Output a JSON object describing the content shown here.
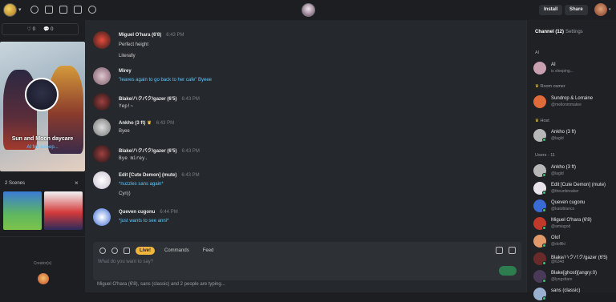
{
  "top": {
    "install_label": "Install",
    "share_label": "Share"
  },
  "left": {
    "stats": {
      "hearts": "0",
      "chats": "0"
    },
    "scene": {
      "title": "Sun and Moon daycare",
      "status": "AI fell asleep..."
    },
    "scenes_label": "2 Scenes",
    "creators_label": "Creator(s)"
  },
  "messages": [
    {
      "name": "Miguel O'hara (6'8)",
      "time": "6:43 PM",
      "lines": [
        "Perfect height",
        "Literally"
      ],
      "style": [
        "",
        ""
      ],
      "color": "#c0392b"
    },
    {
      "name": "Mirey",
      "time": "",
      "lines": [
        "\"leaves again to go back to her cafe\" Byeee"
      ],
      "style": [
        "cyan"
      ],
      "color": "#b98fa0"
    },
    {
      "name": "Blake/ハクバク/gazer (6'5)",
      "time": "6:43 PM",
      "lines": [
        "Yep!~"
      ],
      "style": [
        "mono"
      ],
      "color": "#6b2a2a"
    },
    {
      "name": "Ankho (3 ft)",
      "time": "6:43 PM",
      "lines": [
        "Byee"
      ],
      "style": [
        ""
      ],
      "color": "#b7b7b7"
    },
    {
      "name": "Blake/ハクバク/gazer (6'5)",
      "time": "6:43 PM",
      "lines": [
        "Bye mirey."
      ],
      "style": [
        "mono"
      ],
      "color": "#6b2a2a"
    },
    {
      "name": "Edit [Cute Demon] (mute)",
      "time": "6:43 PM",
      "lines": [
        "*nuzzles sans again*",
        "Cyn))"
      ],
      "style": [
        "cyan",
        ""
      ],
      "color": "#e8e2ea"
    },
    {
      "name": "Queven cugonu",
      "time": "6:44 PM",
      "lines": [
        "*just wants to see anni*"
      ],
      "style": [
        "cyan"
      ],
      "color": "#3a6bd5"
    }
  ],
  "composer": {
    "tabs": [
      "Live!",
      "Commands",
      "Feed"
    ],
    "placeholder": "What do you want to say?",
    "typing": "Miguel O'hara (6'8), sans (classic) and 2 people are typing..."
  },
  "right": {
    "tabs": [
      "Channel (12)",
      "Settings"
    ],
    "ai_section": "AI",
    "ai_user": {
      "name": "AI",
      "handle": "is sleeping...",
      "color": "#c9a0b0"
    },
    "owner_section": "Room owner",
    "owner_user": {
      "name": "Sundrop & Lorraine",
      "handle": "@mellonmmatee",
      "color": "#e06b3a"
    },
    "host_section": "Host",
    "host_user": {
      "name": "Ankho (3 ft)",
      "handle": "@lagld",
      "color": "#b7b7b7"
    },
    "users_section": "Users - 11",
    "users": [
      {
        "name": "Ankho (3 ft)",
        "handle": "@lagld",
        "color": "#b7b7b7"
      },
      {
        "name": "Edit [Cute Demon] (mute)",
        "handle": "@theunbreaker",
        "color": "#e8e2ea"
      },
      {
        "name": "Queven cugonu",
        "handle": "@katoblanco",
        "color": "#3a6bd5"
      },
      {
        "name": "Miguel O'hara (6'8)",
        "handle": "@amiagod",
        "color": "#c0392b"
      },
      {
        "name": "Olof",
        "handle": "@dolfikl",
        "color": "#e09a6a"
      },
      {
        "name": "Blake/ハクバク/gazer (6'5)",
        "handle": "@634d",
        "color": "#6b2a2a"
      },
      {
        "name": "Blake[ghost](angry:0)",
        "handle": "@lyngsttam",
        "color": "#4a3a5a"
      },
      {
        "name": "sans (classic)",
        "handle": "",
        "color": "#9ab0d0"
      }
    ]
  }
}
